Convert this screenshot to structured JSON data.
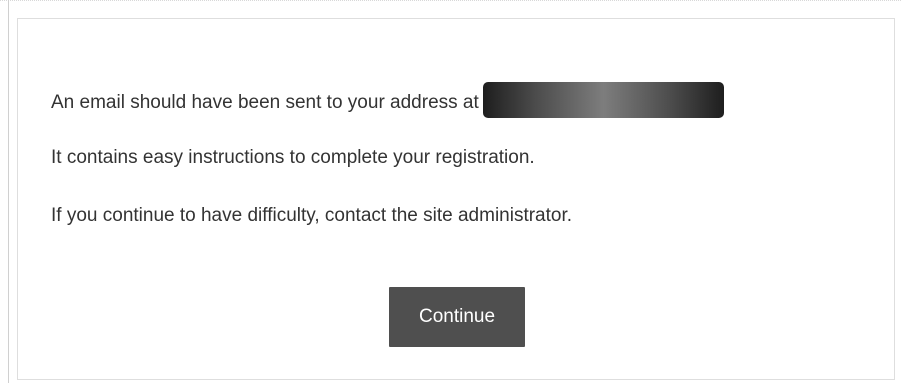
{
  "message": {
    "line1": "An email should have been sent to your address at",
    "line2": "It contains easy instructions to complete your registration.",
    "line3": "If you continue to have difficulty, contact the site administrator."
  },
  "actions": {
    "continue_label": "Continue"
  }
}
